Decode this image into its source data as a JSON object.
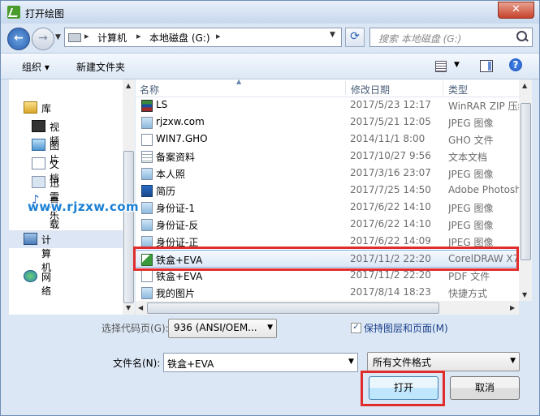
{
  "window": {
    "title": "打开绘图",
    "close_glyph": "✕"
  },
  "address": {
    "crumbs": [
      "计算机",
      "本地磁盘 (G:)"
    ],
    "search_placeholder": "搜索 本地磁盘 (G:)"
  },
  "toolbar": {
    "organize": "组织 ▾",
    "new_folder": "新建文件夹"
  },
  "nav": {
    "items": [
      {
        "label": "库",
        "icon": "library-icon"
      },
      {
        "label": "视频",
        "icon": "video-folder-icon"
      },
      {
        "label": "图片",
        "icon": "picture-folder-icon"
      },
      {
        "label": "文档",
        "icon": "document-folder-icon"
      },
      {
        "label": "迅雷下载",
        "icon": "download-folder-icon"
      },
      {
        "label": "音乐",
        "icon": "music-icon"
      },
      {
        "label": "计算机",
        "icon": "computer-icon"
      },
      {
        "label": "网络",
        "icon": "network-icon"
      }
    ]
  },
  "columns": {
    "name": "名称",
    "date": "修改日期",
    "type": "类型"
  },
  "files": [
    {
      "name": "LS",
      "date": "2017/5/23 12:17",
      "type": "WinRAR ZIP 压缩",
      "icon": "rar"
    },
    {
      "name": "rjzxw.com",
      "date": "2017/5/21 12:05",
      "type": "JPEG 图像",
      "icon": "jpg"
    },
    {
      "name": "WIN7.GHO",
      "date": "2014/11/1 8:00",
      "type": "GHO 文件",
      "icon": "gho"
    },
    {
      "name": "备案资料",
      "date": "2017/10/27 9:56",
      "type": "文本文档",
      "icon": "txt"
    },
    {
      "name": "本人照",
      "date": "2017/3/16 23:07",
      "type": "JPEG 图像",
      "icon": "jpg"
    },
    {
      "name": "简历",
      "date": "2017/7/25 14:50",
      "type": "Adobe Photoshop",
      "icon": "doc"
    },
    {
      "name": "身份证-1",
      "date": "2017/6/22 14:10",
      "type": "JPEG 图像",
      "icon": "jpg"
    },
    {
      "name": "身份证-反",
      "date": "2017/6/22 14:10",
      "type": "JPEG 图像",
      "icon": "jpg"
    },
    {
      "name": "身份证-正",
      "date": "2017/6/22 14:09",
      "type": "JPEG 图像",
      "icon": "jpg"
    },
    {
      "name": "铁盒+EVA",
      "date": "2017/11/2 22:20",
      "type": "CorelDRAW X7",
      "icon": "cdr",
      "selected": true
    },
    {
      "name": "铁盒+EVA",
      "date": "2017/11/2 22:20",
      "type": "PDF 文件",
      "icon": "pdf"
    },
    {
      "name": "我的图片",
      "date": "2017/8/14 18:23",
      "type": "快捷方式",
      "icon": "lnk"
    }
  ],
  "watermark": "www.rjzxw.com",
  "bottom": {
    "codepage_label": "选择代码页(G):",
    "codepage_value": "936  (ANSI/OEM...",
    "keep_layers_label": "保持图层和页面(M)",
    "keep_layers_checked": "✓",
    "filename_label": "文件名(N):",
    "filename_value": "铁盒+EVA",
    "filetype_value": "所有文件格式",
    "open_button": "打开",
    "cancel_button": "取消"
  },
  "colors": {
    "accent": "#3c7fb1",
    "annotation": "#e02c2c",
    "watermark": "#1a7fd4"
  }
}
